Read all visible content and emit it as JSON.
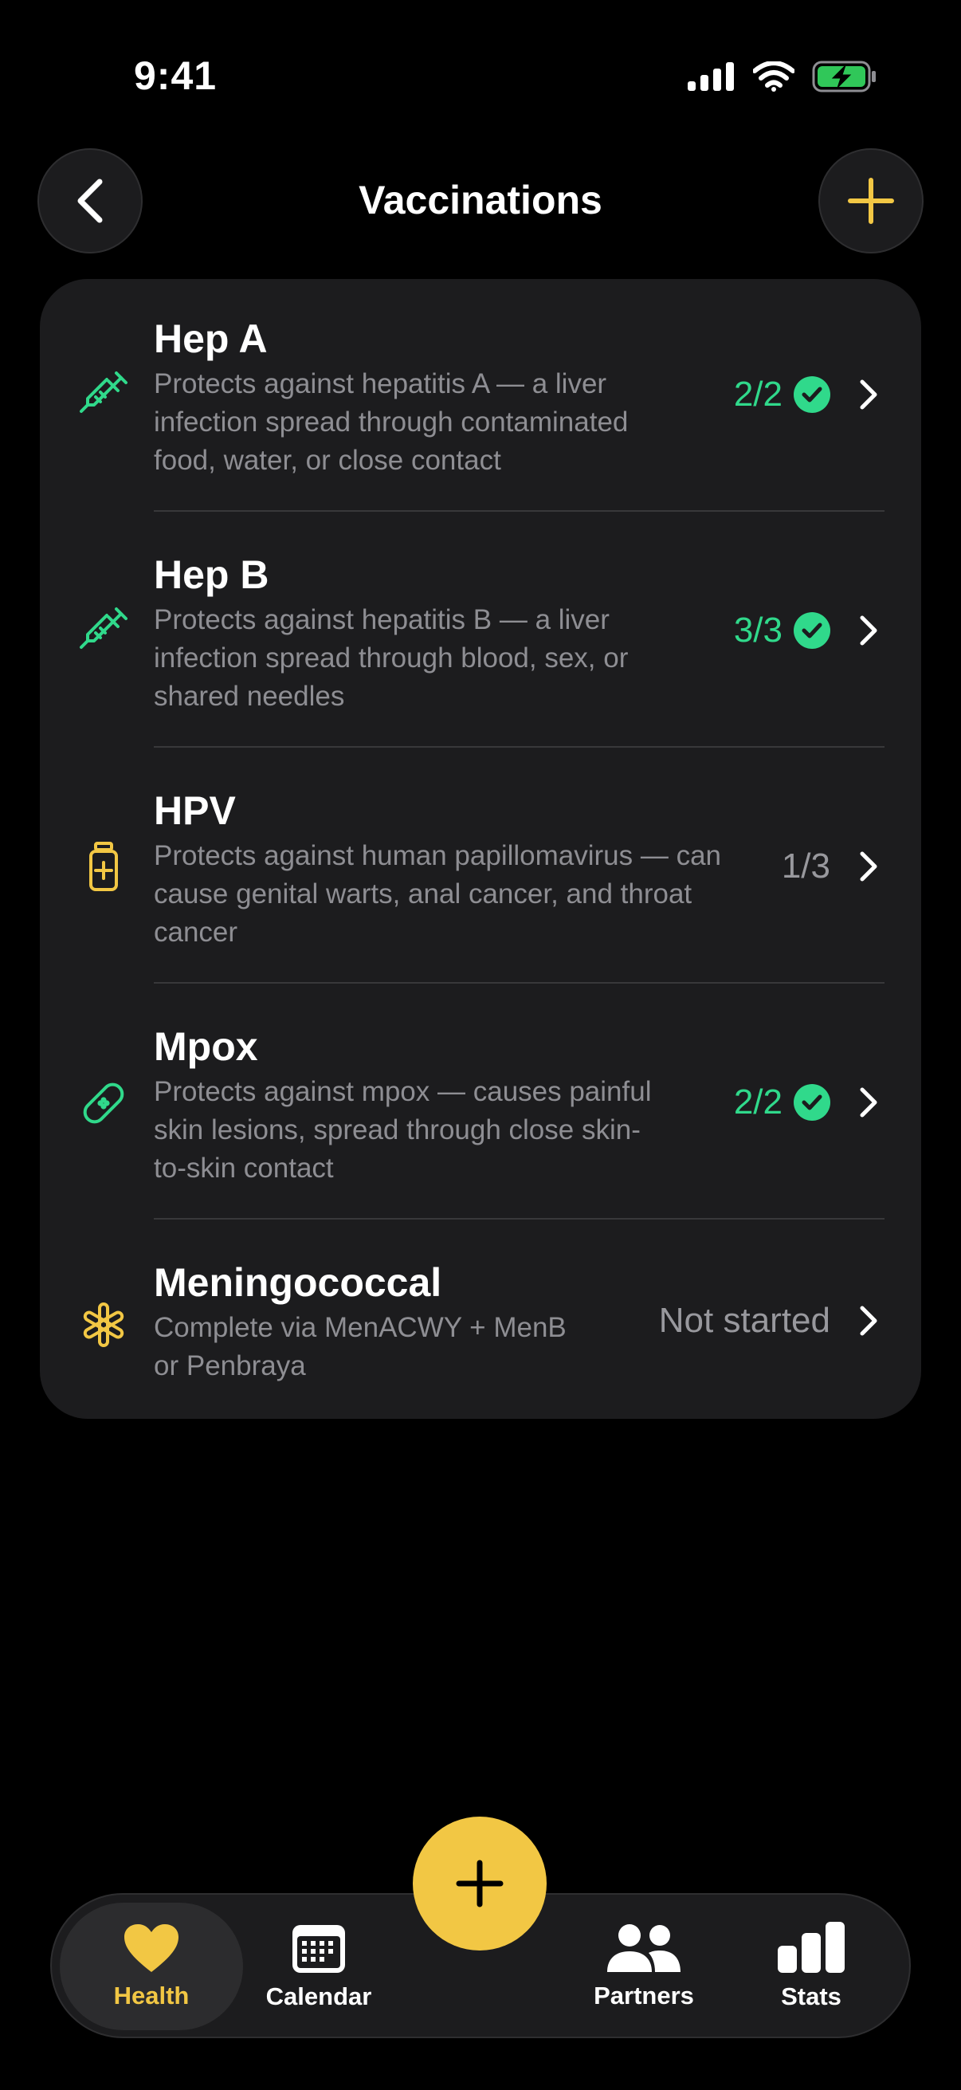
{
  "status_bar": {
    "time": "9:41"
  },
  "header": {
    "title": "Vaccinations"
  },
  "colors": {
    "accent": "#f2c744",
    "success": "#30d98b",
    "background": "#000000",
    "card": "#1c1c1e"
  },
  "vaccines": [
    {
      "name": "Hep A",
      "description_lines": [
        "Protects against hepatitis A — a liver",
        "infection spread through contaminated",
        "food, water, or close contact"
      ],
      "status": "2/2",
      "completed": true,
      "icon": "syringe-icon"
    },
    {
      "name": "Hep B",
      "description_lines": [
        "Protects against hepatitis B — a liver",
        "infection spread through blood, sex, or",
        "shared needles"
      ],
      "status": "3/3",
      "completed": true,
      "icon": "syringe-icon"
    },
    {
      "name": "HPV",
      "description_lines": [
        "Protects against human papillomavirus — can",
        "cause genital warts, anal cancer, and throat",
        "cancer"
      ],
      "status": "1/3",
      "completed": false,
      "icon": "medicine-vial-icon"
    },
    {
      "name": "Mpox",
      "description_lines": [
        "Protects against mpox — causes painful",
        "skin lesions, spread through close skin-",
        "to-skin contact"
      ],
      "status": "2/2",
      "completed": true,
      "icon": "bandage-icon"
    },
    {
      "name": "Meningococcal",
      "description_lines": [
        "Complete via MenACWY + MenB",
        "or Penbraya"
      ],
      "status": "Not started",
      "completed": false,
      "icon": "asterisk-icon"
    }
  ],
  "tab_bar": {
    "tabs": [
      {
        "label": "Health",
        "icon": "heart-icon",
        "active": true
      },
      {
        "label": "Calendar",
        "icon": "calendar-icon",
        "active": false
      },
      {
        "label": "Partners",
        "icon": "people-icon",
        "active": false
      },
      {
        "label": "Stats",
        "icon": "bar-chart-icon",
        "active": false
      }
    ]
  }
}
